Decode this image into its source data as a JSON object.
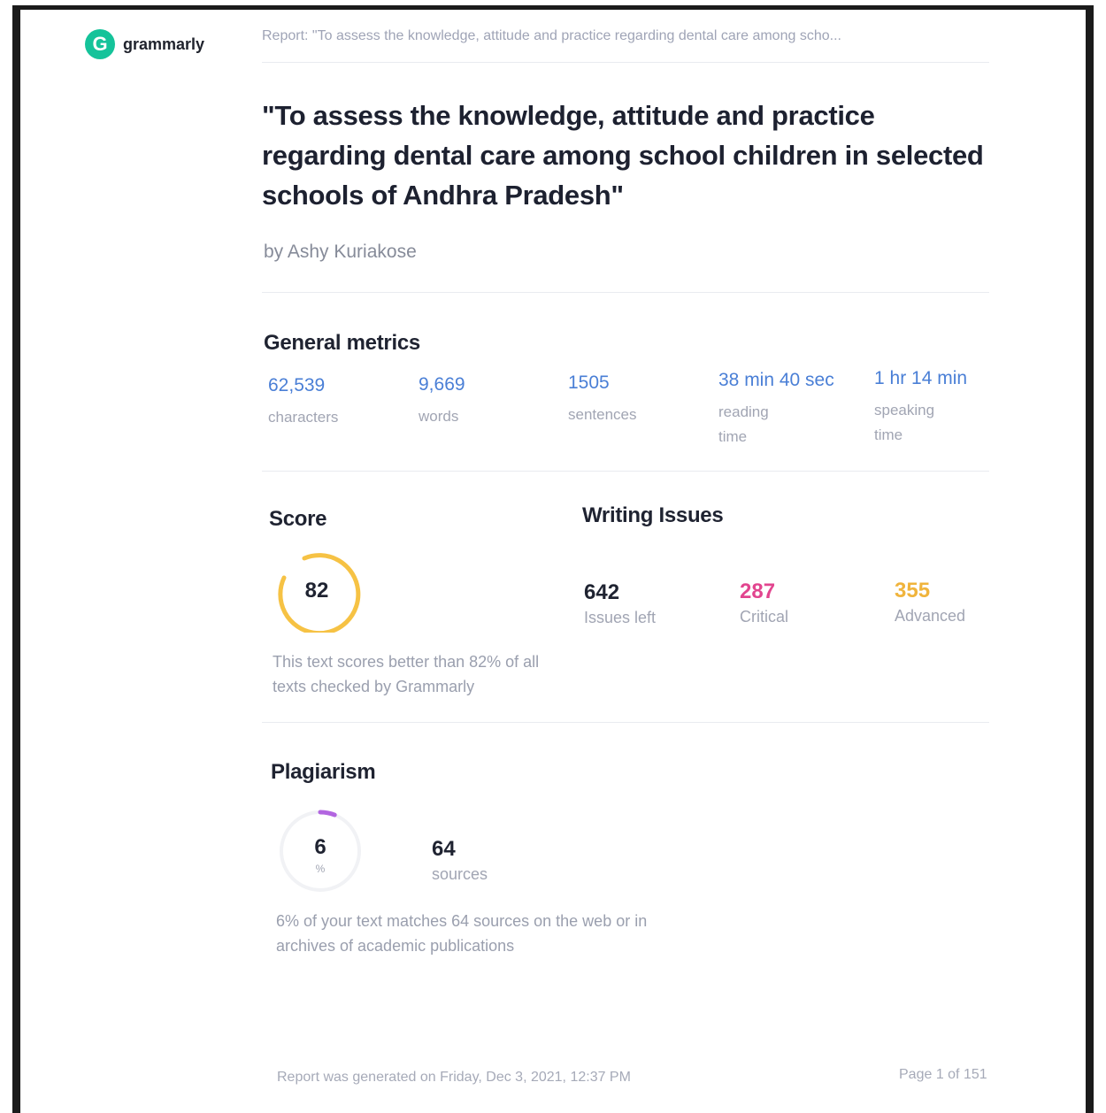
{
  "header": {
    "brand": "grammarly",
    "brand_initial": "G",
    "report_title": "Report: \"To assess the knowledge, attitude and practice regarding dental care among scho..."
  },
  "document": {
    "title": "\"To assess the knowledge, attitude and practice regarding dental care among school children in selected schools of Andhra Pradesh\"",
    "author": "by Ashy Kuriakose"
  },
  "general_metrics": {
    "title": "General metrics",
    "items": [
      {
        "value": "62,539",
        "label": "characters"
      },
      {
        "value": "9,669",
        "label": "words"
      },
      {
        "value": "1505",
        "label": "sentences"
      },
      {
        "value": "38 min 40 sec",
        "label": "reading time"
      },
      {
        "value": "1 hr 14 min",
        "label": "speaking time"
      }
    ]
  },
  "score": {
    "title": "Score",
    "value": "82",
    "description": "This text scores better than 82% of all texts checked by Grammarly",
    "ring_color": "#f6c244"
  },
  "writing_issues": {
    "title": "Writing Issues",
    "items": [
      {
        "value": "642",
        "label": "Issues left",
        "color": "#1f2331"
      },
      {
        "value": "287",
        "label": "Critical",
        "color": "#e2458f"
      },
      {
        "value": "355",
        "label": "Advanced",
        "color": "#f0b43c"
      }
    ]
  },
  "plagiarism": {
    "title": "Plagiarism",
    "percent": "6",
    "percent_unit": "%",
    "sources_count": "64",
    "sources_label": "sources",
    "description": "6% of your text matches 64 sources on the web or in archives of academic publications",
    "ring_color": "#b265e0"
  },
  "footer": {
    "generated": "Report was generated on Friday, Dec 3, 2021, 12:37 PM",
    "page": "Page 1 of 151"
  }
}
